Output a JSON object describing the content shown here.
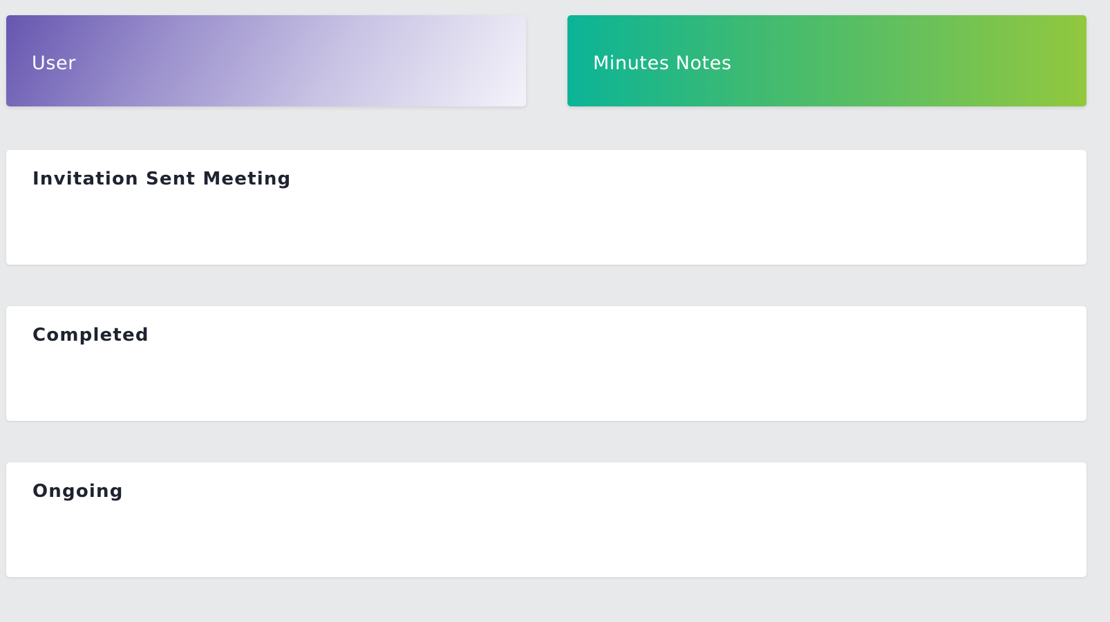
{
  "stat_cards": {
    "user": {
      "label": "User",
      "gradient": [
        "#6656b0",
        "#f4f3fa"
      ]
    },
    "minutes_notes": {
      "label": "Minutes Notes",
      "gradient": [
        "#0bb497",
        "#92c83e"
      ]
    }
  },
  "panels": {
    "invitation": {
      "title": "Invitation Sent Meeting"
    },
    "completed": {
      "title": "Completed"
    },
    "ongoing": {
      "title": "Ongoing"
    }
  }
}
